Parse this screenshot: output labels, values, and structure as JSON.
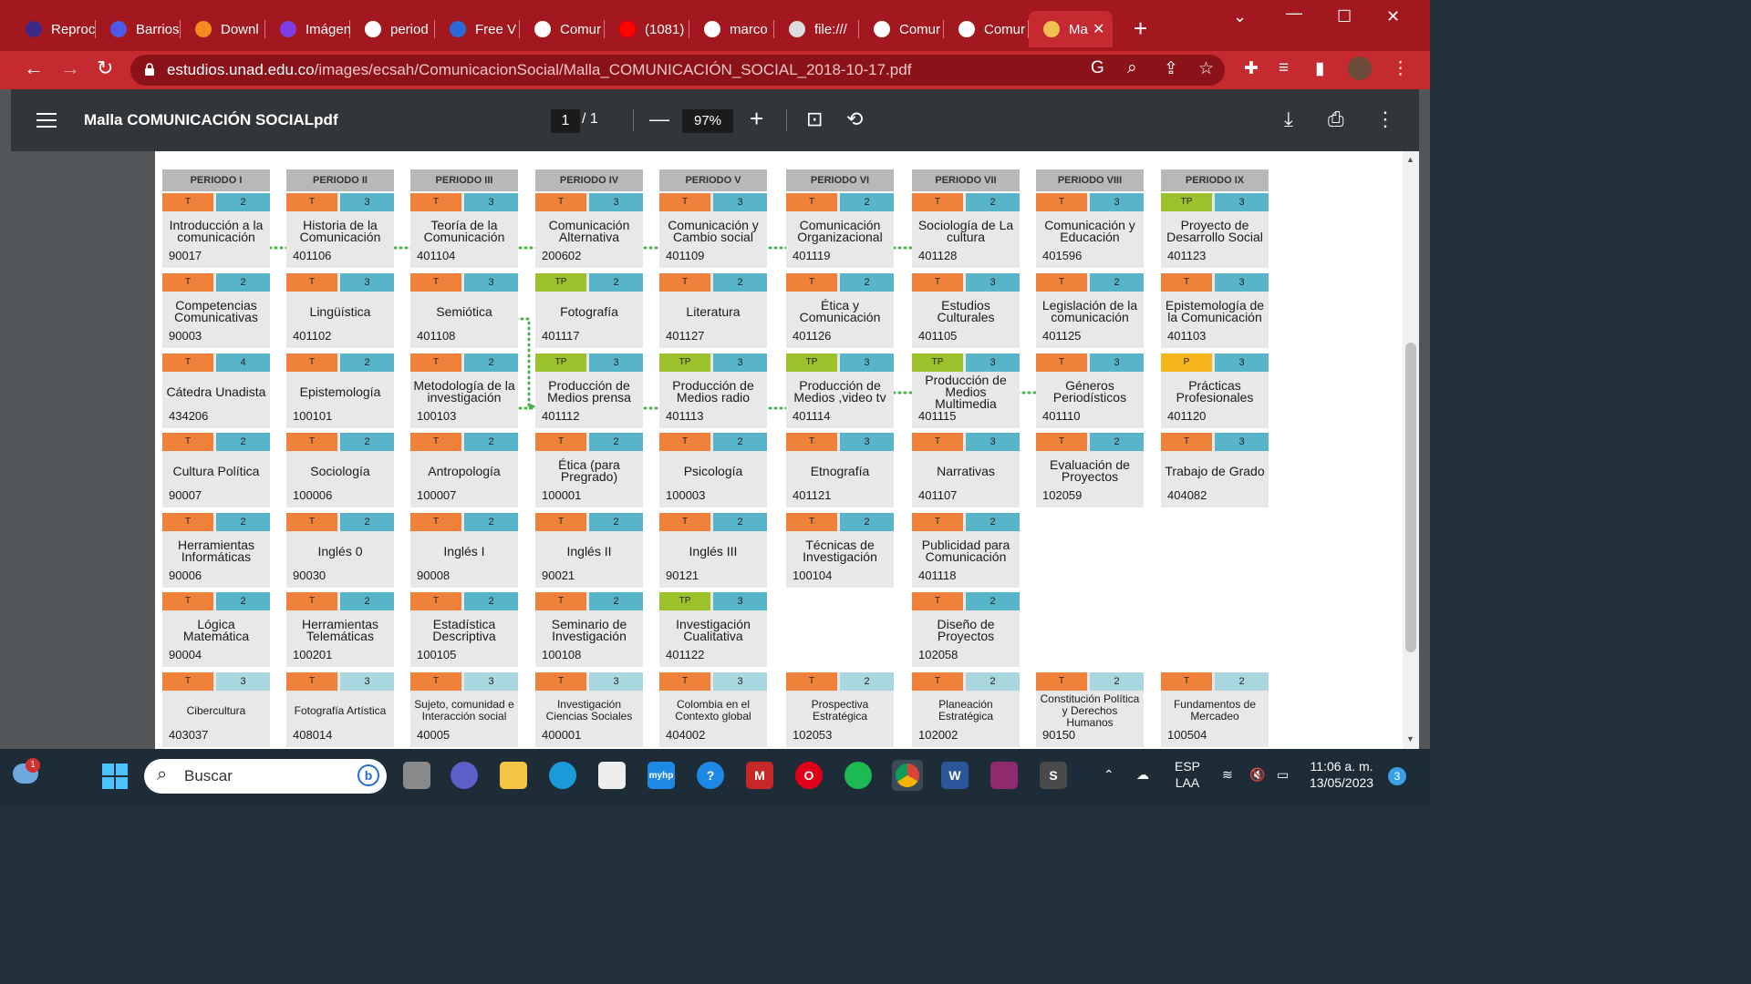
{
  "browser": {
    "tabs": [
      {
        "label": "Reproc",
        "icon": "reproc-icon",
        "color": "#3b2a8a"
      },
      {
        "label": "Barrios",
        "icon": "app-icon",
        "color": "#5058e6"
      },
      {
        "label": "Downl",
        "icon": "sublime-icon",
        "color": "#f58a1f"
      },
      {
        "label": "Imágen",
        "icon": "b-icon",
        "color": "#7b3fe4"
      },
      {
        "label": "period",
        "icon": "google-icon",
        "color": "#ffffff"
      },
      {
        "label": "Free V",
        "icon": "free-icon",
        "color": "#2a6ad8"
      },
      {
        "label": "Comur",
        "icon": "unad-icon",
        "color": "#ffffff"
      },
      {
        "label": "(1081)",
        "icon": "youtube-icon",
        "color": "#ff0000"
      },
      {
        "label": "marco",
        "icon": "unad-icon",
        "color": "#ffffff"
      },
      {
        "label": "file:///",
        "icon": "globe-icon",
        "color": "#dddddd"
      },
      {
        "label": "Comur",
        "icon": "unad-icon",
        "color": "#ffffff"
      },
      {
        "label": "Comur",
        "icon": "unad-icon",
        "color": "#ffffff"
      },
      {
        "label": "Ma",
        "icon": "pdf-icon",
        "color": "#f2c04e",
        "active": true
      }
    ],
    "url_domain": "estudios.unad.edu.co",
    "url_path": "/images/ecsah/ComunicacionSocial/Malla_COMUNICACIÓN_SOCIAL_2018-10-17.pdf"
  },
  "pdf": {
    "title": "Malla COMUNICACIÓN SOCIALpdf",
    "page_current": "1",
    "page_total": "/   1",
    "zoom": "97%"
  },
  "periods": [
    "PERIODO I",
    "PERIODO II",
    "PERIODO III",
    "PERIODO IV",
    "PERIODO V",
    "PERIODO VI",
    "PERIODO VII",
    "PERIODO VIII",
    "PERIODO IX"
  ],
  "courses": [
    [
      {
        "type": "T",
        "credits": "2",
        "name": "Introducción a la comunicación",
        "code": "90017"
      },
      {
        "type": "T",
        "credits": "2",
        "name": "Competencias Comunicativas",
        "code": "90003"
      },
      {
        "type": "T",
        "credits": "4",
        "name": "Cátedra Unadista",
        "code": "434206"
      },
      {
        "type": "T",
        "credits": "2",
        "name": "Cultura Política",
        "code": "90007"
      },
      {
        "type": "T",
        "credits": "2",
        "name": "Herramientas Informáticas",
        "code": "90006"
      },
      {
        "type": "T",
        "credits": "2",
        "name": "Lógica Matemática",
        "code": "90004"
      },
      {
        "type": "T",
        "credits": "3",
        "name": "Cibercultura",
        "code": "403037",
        "light": true
      }
    ],
    [
      {
        "type": "T",
        "credits": "3",
        "name": "Historia de la Comunicación",
        "code": "401106"
      },
      {
        "type": "T",
        "credits": "3",
        "name": "Lingüística",
        "code": "401102"
      },
      {
        "type": "T",
        "credits": "2",
        "name": "Epistemología",
        "code": "100101"
      },
      {
        "type": "T",
        "credits": "2",
        "name": "Sociología",
        "code": "100006"
      },
      {
        "type": "T",
        "credits": "2",
        "name": "Inglés 0",
        "code": "90030"
      },
      {
        "type": "T",
        "credits": "2",
        "name": "Herramientas Telemáticas",
        "code": "100201"
      },
      {
        "type": "T",
        "credits": "3",
        "name": "Fotografía Artística",
        "code": "408014",
        "light": true
      }
    ],
    [
      {
        "type": "T",
        "credits": "3",
        "name": "Teoría de la Comunicación",
        "code": "401104"
      },
      {
        "type": "T",
        "credits": "3",
        "name": "Semiótica",
        "code": "401108"
      },
      {
        "type": "T",
        "credits": "2",
        "name": "Metodología de la investigación",
        "code": "100103"
      },
      {
        "type": "T",
        "credits": "2",
        "name": "Antropología",
        "code": "100007"
      },
      {
        "type": "T",
        "credits": "2",
        "name": "Inglés I",
        "code": "90008"
      },
      {
        "type": "T",
        "credits": "2",
        "name": "Estadística Descriptiva",
        "code": "100105"
      },
      {
        "type": "T",
        "credits": "3",
        "name": "Sujeto, comunidad e Interacción social",
        "code": "40005",
        "light": true
      }
    ],
    [
      {
        "type": "T",
        "credits": "3",
        "name": "Comunicación Alternativa",
        "code": "200602"
      },
      {
        "type": "TP",
        "credits": "2",
        "name": "Fotografía",
        "code": "401117"
      },
      {
        "type": "TP",
        "credits": "3",
        "name": "Producción de Medios prensa",
        "code": "401112"
      },
      {
        "type": "T",
        "credits": "2",
        "name": "Ética (para Pregrado)",
        "code": "100001"
      },
      {
        "type": "T",
        "credits": "2",
        "name": "Inglés II",
        "code": "90021"
      },
      {
        "type": "T",
        "credits": "2",
        "name": "Seminario de Investigación",
        "code": "100108"
      },
      {
        "type": "T",
        "credits": "3",
        "name": "Investigación Ciencias Sociales",
        "code": "400001",
        "light": true
      }
    ],
    [
      {
        "type": "T",
        "credits": "3",
        "name": "Comunicación y Cambio social",
        "code": "401109"
      },
      {
        "type": "T",
        "credits": "2",
        "name": "Literatura",
        "code": "401127"
      },
      {
        "type": "TP",
        "credits": "3",
        "name": "Producción de Medios radio",
        "code": "401113"
      },
      {
        "type": "T",
        "credits": "2",
        "name": "Psicología",
        "code": "100003"
      },
      {
        "type": "T",
        "credits": "2",
        "name": "Inglés III",
        "code": "90121"
      },
      {
        "type": "TP",
        "credits": "3",
        "name": "Investigación Cualitativa",
        "code": "401122"
      },
      {
        "type": "T",
        "credits": "3",
        "name": "Colombia en el Contexto global",
        "code": "404002",
        "light": true
      }
    ],
    [
      {
        "type": "T",
        "credits": "2",
        "name": "Comunicación Organizacional",
        "code": "401119"
      },
      {
        "type": "T",
        "credits": "2",
        "name": "Ética y Comunicación",
        "code": "401126"
      },
      {
        "type": "TP",
        "credits": "3",
        "name": "Producción de Medios ,video tv",
        "code": "401114"
      },
      {
        "type": "T",
        "credits": "3",
        "name": "Etnografía",
        "code": "401121"
      },
      {
        "type": "T",
        "credits": "2",
        "name": "Técnicas de Investigación",
        "code": "100104"
      },
      null,
      {
        "type": "T",
        "credits": "2",
        "name": "Prospectiva Estratégica",
        "code": "102053",
        "light": true
      }
    ],
    [
      {
        "type": "T",
        "credits": "2",
        "name": "Sociología de La cultura",
        "code": "401128"
      },
      {
        "type": "T",
        "credits": "3",
        "name": "Estudios Culturales",
        "code": "401105"
      },
      {
        "type": "TP",
        "credits": "3",
        "name": "Producción de Medios Multimedia",
        "code": "401115"
      },
      {
        "type": "T",
        "credits": "3",
        "name": "Narrativas",
        "code": "401107"
      },
      {
        "type": "T",
        "credits": "2",
        "name": "Publicidad para Comunicación",
        "code": "401118"
      },
      {
        "type": "T",
        "credits": "2",
        "name": "Diseño de Proyectos",
        "code": "102058"
      },
      {
        "type": "T",
        "credits": "2",
        "name": "Planeación Estratégica",
        "code": "102002",
        "light": true
      }
    ],
    [
      {
        "type": "T",
        "credits": "3",
        "name": "Comunicación y Educación",
        "code": "401596"
      },
      {
        "type": "T",
        "credits": "2",
        "name": "Legislación de la comunicación",
        "code": "401125"
      },
      {
        "type": "T",
        "credits": "3",
        "name": "Géneros Periodísticos",
        "code": "401110"
      },
      {
        "type": "T",
        "credits": "2",
        "name": "Evaluación de Proyectos",
        "code": "102059"
      },
      null,
      null,
      {
        "type": "T",
        "credits": "2",
        "name": "Constitución Política y Derechos Humanos",
        "code": "90150",
        "light": true
      }
    ],
    [
      {
        "type": "TP",
        "credits": "3",
        "name": "Proyecto de Desarrollo Social",
        "code": "401123"
      },
      {
        "type": "T",
        "credits": "3",
        "name": "Epistemología de la Comunicación",
        "code": "401103"
      },
      {
        "type": "P",
        "credits": "3",
        "name": "Prácticas Profesionales",
        "code": "401120"
      },
      {
        "type": "T",
        "credits": "3",
        "name": "Trabajo de Grado",
        "code": "404082"
      },
      null,
      null,
      {
        "type": "T",
        "credits": "2",
        "name": "Fundamentos de Mercadeo",
        "code": "100504",
        "light": true
      }
    ]
  ],
  "taskbar": {
    "search_placeholder": "Buscar",
    "notification_count": "1",
    "lang_line1": "ESP",
    "lang_line2": "LAA",
    "time": "11:06 a. m.",
    "date": "13/05/2023",
    "notif_badge": "3"
  },
  "colors": {
    "tab_strip": "#a3171f",
    "type_T": "#f0813b",
    "type_TP": "#9cc22b",
    "type_P": "#f6b51d",
    "credit": "#58b4c8",
    "connector": "#4caf50"
  }
}
